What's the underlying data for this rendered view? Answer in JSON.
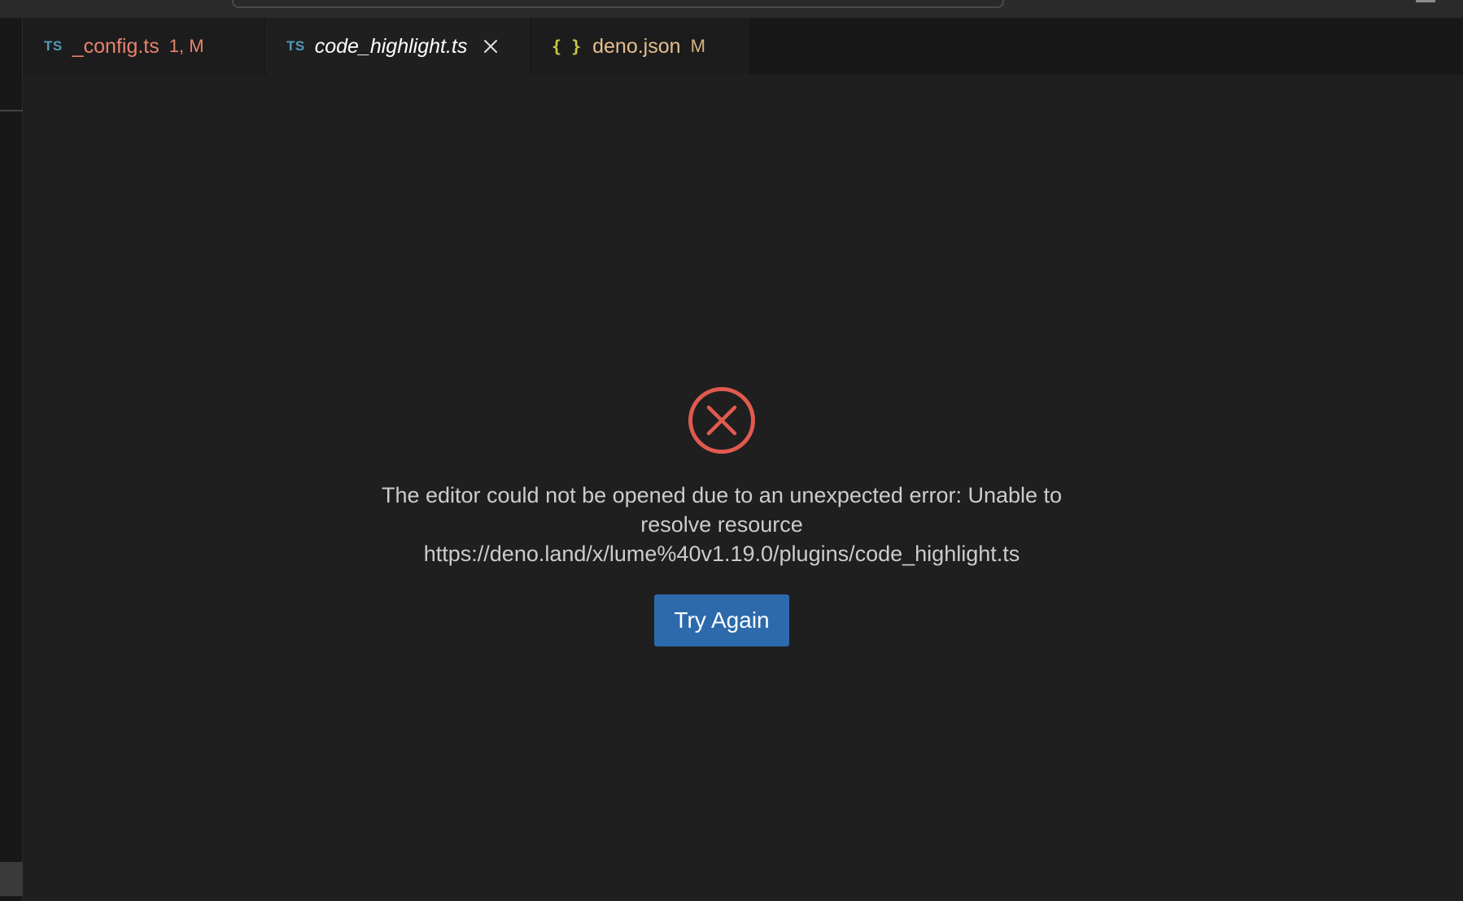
{
  "tabs": [
    {
      "icon": "TS",
      "label": "_config.ts",
      "badge": "1, M"
    },
    {
      "icon": "TS",
      "label": "code_highlight.ts",
      "badge": ""
    },
    {
      "icon": "{ }",
      "label": "deno.json",
      "badge": "M"
    }
  ],
  "error": {
    "icon": "error-circle-icon",
    "message": "The editor could not be opened due to an unexpected error: Unable to resolve resource https://deno.land/x/lume%40v1.19.0/plugins/code_highlight.ts",
    "retry_label": "Try Again"
  },
  "colors": {
    "background": "#1f1f1f",
    "tab_modified_error": "#e8836d",
    "tab_modified": "#e2c08d",
    "ts_icon": "#519aba",
    "json_icon": "#cbcb41",
    "error_icon": "#e05a4f",
    "button": "#2c6aac"
  }
}
